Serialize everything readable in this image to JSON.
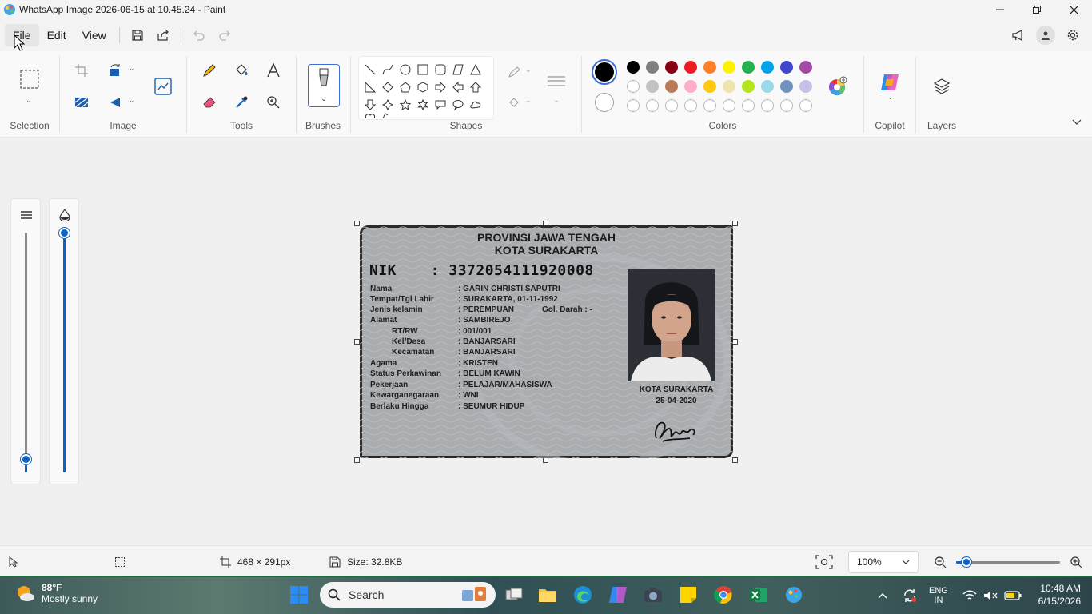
{
  "window": {
    "title": "WhatsApp Image 2026-06-15 at 10.45.24 - Paint"
  },
  "menu": {
    "file": "File",
    "edit": "Edit",
    "view": "View"
  },
  "ribbon": {
    "groups": {
      "selection": "Selection",
      "image": "Image",
      "tools": "Tools",
      "brushes": "Brushes",
      "shapes": "Shapes",
      "colors": "Colors",
      "copilot": "Copilot",
      "layers": "Layers"
    },
    "palette_row1": [
      "#000000",
      "#7f7f7f",
      "#880015",
      "#ed1c24",
      "#ff7f27",
      "#fff200",
      "#22b14c",
      "#00a2e8",
      "#3f48cc",
      "#a349a4"
    ],
    "palette_row2": [
      "#ffffff",
      "#c3c3c3",
      "#b97a57",
      "#ffaec9",
      "#ffc90e",
      "#efe4b0",
      "#b5e61d",
      "#99d9ea",
      "#7092be",
      "#c8bfe7"
    ],
    "primary_color": "#000000",
    "secondary_color": "#ffffff"
  },
  "idcard": {
    "header_line1": "PROVINSI JAWA TENGAH",
    "header_line2": "KOTA SURAKARTA",
    "nik_label": "NIK",
    "nik_value": ": 3372054111920008",
    "fields": [
      {
        "label": "Nama",
        "value": ": GARIN CHRISTI SAPUTRI"
      },
      {
        "label": "Tempat/Tgl Lahir",
        "value": ": SURAKARTA, 01-11-1992"
      },
      {
        "label": "Jenis kelamin",
        "value": ": PEREMPUAN",
        "extra": "Gol. Darah  : -"
      },
      {
        "label": "Alamat",
        "value": ": SAMBIREJO"
      },
      {
        "label": "RT/RW",
        "value": ": 001/001"
      },
      {
        "label": "Kel/Desa",
        "value": ": BANJARSARI"
      },
      {
        "label": "Kecamatan",
        "value": ": BANJARSARI"
      },
      {
        "label": "Agama",
        "value": ": KRISTEN"
      },
      {
        "label": "Status Perkawinan",
        "value": ": BELUM KAWIN"
      },
      {
        "label": "Pekerjaan",
        "value": ": PELAJAR/MAHASISWA"
      },
      {
        "label": "Kewarganegaraan",
        "value": ": WNI"
      },
      {
        "label": "Berlaku Hingga",
        "value": ": SEUMUR HIDUP"
      }
    ],
    "issued_place": "KOTA SURAKARTA",
    "issued_date": "25-04-2020"
  },
  "status": {
    "dimensions": "468 × 291px",
    "size": "Size: 32.8KB",
    "zoom": "100%",
    "zoom_fraction": 0.1
  },
  "side_sliders": {
    "thickness_fraction": 0.03,
    "opacity_fraction": 1.0
  },
  "taskbar": {
    "temperature": "88°F",
    "weather": "Mostly sunny",
    "search_placeholder": "Search",
    "lang_line1": "ENG",
    "lang_line2": "IN",
    "time": "10:48 AM",
    "date": "6/15/2026"
  }
}
